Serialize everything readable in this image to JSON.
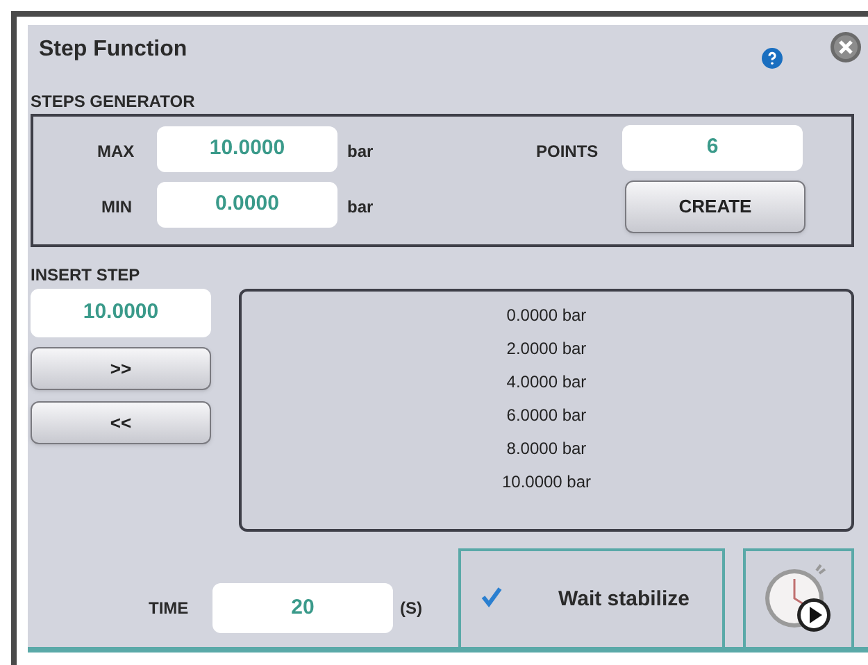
{
  "title": "Step Function",
  "steps_generator": {
    "label": "STEPS GENERATOR",
    "max": {
      "label": "MAX",
      "value": "10.0000",
      "unit": "bar"
    },
    "min": {
      "label": "MIN",
      "value": "0.0000",
      "unit": "bar"
    },
    "points": {
      "label": "POINTS",
      "value": "6"
    },
    "create_button": "CREATE"
  },
  "insert_step": {
    "label": "INSERT STEP",
    "value": "10.0000",
    "add_button": ">>",
    "remove_button": "<<"
  },
  "steps": [
    "0.0000 bar",
    "2.0000 bar",
    "4.0000 bar",
    "6.0000 bar",
    "8.0000 bar",
    "10.0000 bar"
  ],
  "time": {
    "label": "TIME",
    "value": "20",
    "unit": "(S)"
  },
  "wait_stabilize": {
    "label": "Wait stabilize",
    "checked": true
  }
}
